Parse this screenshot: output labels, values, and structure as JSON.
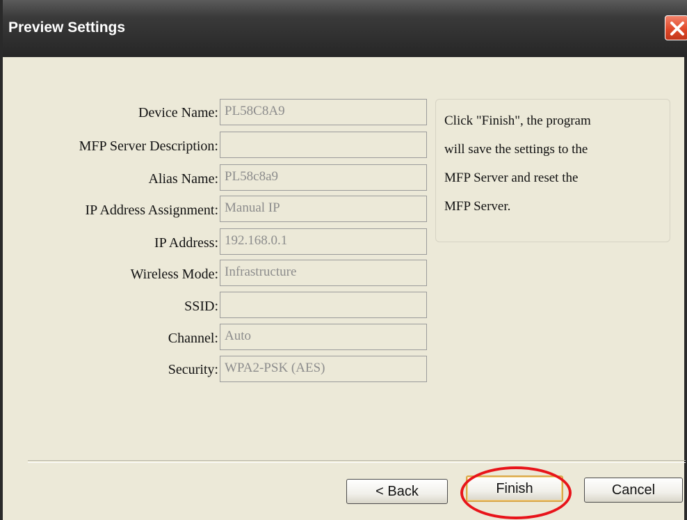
{
  "window": {
    "title": "Preview Settings"
  },
  "form": {
    "rows": [
      {
        "label": "Device Name:",
        "value": "PL58C8A9"
      },
      {
        "label": "MFP Server Description:",
        "value": ""
      },
      {
        "label": "Alias Name:",
        "value": "PL58c8a9"
      },
      {
        "label": "IP Address Assignment:",
        "value": "Manual IP"
      },
      {
        "label": "IP Address:",
        "value": "192.168.0.1"
      },
      {
        "label": "Wireless Mode:",
        "value": "Infrastructure"
      },
      {
        "label": "SSID:",
        "value": ""
      },
      {
        "label": "Channel:",
        "value": "Auto"
      },
      {
        "label": "Security:",
        "value": "WPA2-PSK (AES)"
      }
    ]
  },
  "info": {
    "lines": [
      "Click \"Finish\", the program",
      "will save the settings to the",
      "MFP Server and reset the",
      "MFP Server."
    ]
  },
  "buttons": {
    "back": "< Back",
    "finish": "Finish",
    "cancel": "Cancel"
  },
  "colors": {
    "highlight": "#e8141a",
    "titlebar": "#2e2e2e",
    "close": "#e0492a"
  }
}
